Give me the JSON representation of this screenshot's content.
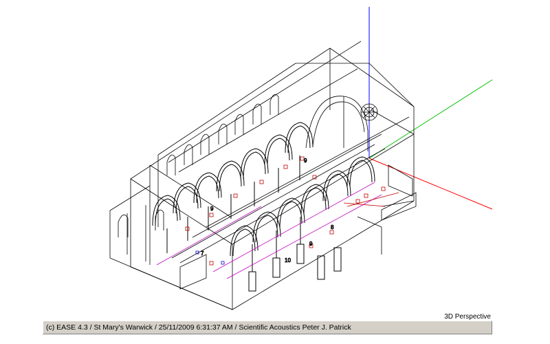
{
  "viewport": {
    "view_mode": "3D Perspective",
    "axis_colors": {
      "x": "#ff0000",
      "y": "#00c000",
      "z": "#0000ff"
    },
    "line_color": "#000000",
    "marker_color": "#c00000",
    "seat_color": "#c000c0",
    "listener_labels": [
      "9",
      "8",
      "9",
      "10",
      "9",
      "7"
    ]
  },
  "status_bar": {
    "text": "(c) EASE 4.3  / St Mary's Warwick  / 25/11/2009 6:31:37 AM / Scientific Acoustics Peter J. Patrick"
  }
}
